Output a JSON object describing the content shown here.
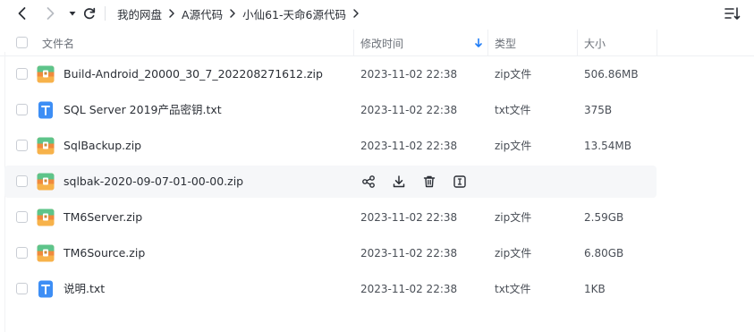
{
  "toolbar": {
    "icons": [
      "back-icon",
      "forward-icon",
      "dropdown-icon",
      "refresh-icon",
      "sort-view-icon"
    ]
  },
  "breadcrumb": [
    "我的网盘",
    "A源代码",
    "小仙61-天命6源代码"
  ],
  "columns": {
    "name": "文件名",
    "modified": "修改时间",
    "type": "类型",
    "size": "大小"
  },
  "files": [
    {
      "name": "Build-Android_20000_30_7_202208271612.zip",
      "date": "2023-11-02 22:38",
      "type": "zip文件",
      "size": "506.86MB",
      "icon": "zip-file-icon"
    },
    {
      "name": "SQL Server 2019产品密钥.txt",
      "date": "2023-11-02 22:38",
      "type": "txt文件",
      "size": "375B",
      "icon": "txt-file-icon"
    },
    {
      "name": "SqlBackup.zip",
      "date": "2023-11-02 22:38",
      "type": "zip文件",
      "size": "13.54MB",
      "icon": "zip-file-icon"
    },
    {
      "name": "sqlbak-2020-09-07-01-00-00.zip",
      "date": "",
      "type": "",
      "size": "",
      "icon": "zip-file-icon",
      "hovered": true,
      "actions": [
        "share-icon",
        "download-icon",
        "delete-icon",
        "rename-icon"
      ]
    },
    {
      "name": "TM6Server.zip",
      "date": "2023-11-02 22:38",
      "type": "zip文件",
      "size": "2.59GB",
      "icon": "zip-file-icon"
    },
    {
      "name": "TM6Source.zip",
      "date": "2023-11-02 22:38",
      "type": "zip文件",
      "size": "6.80GB",
      "icon": "zip-file-icon"
    },
    {
      "name": "说明.txt",
      "date": "2023-11-02 22:38",
      "type": "txt文件",
      "size": "1KB",
      "icon": "txt-file-icon"
    }
  ],
  "colors": {
    "accent": "#1f7cf6",
    "zip_icon_orange": "#f08a3c",
    "zip_icon_green": "#5ec48a",
    "txt_icon_blue": "#3d8ef5"
  }
}
